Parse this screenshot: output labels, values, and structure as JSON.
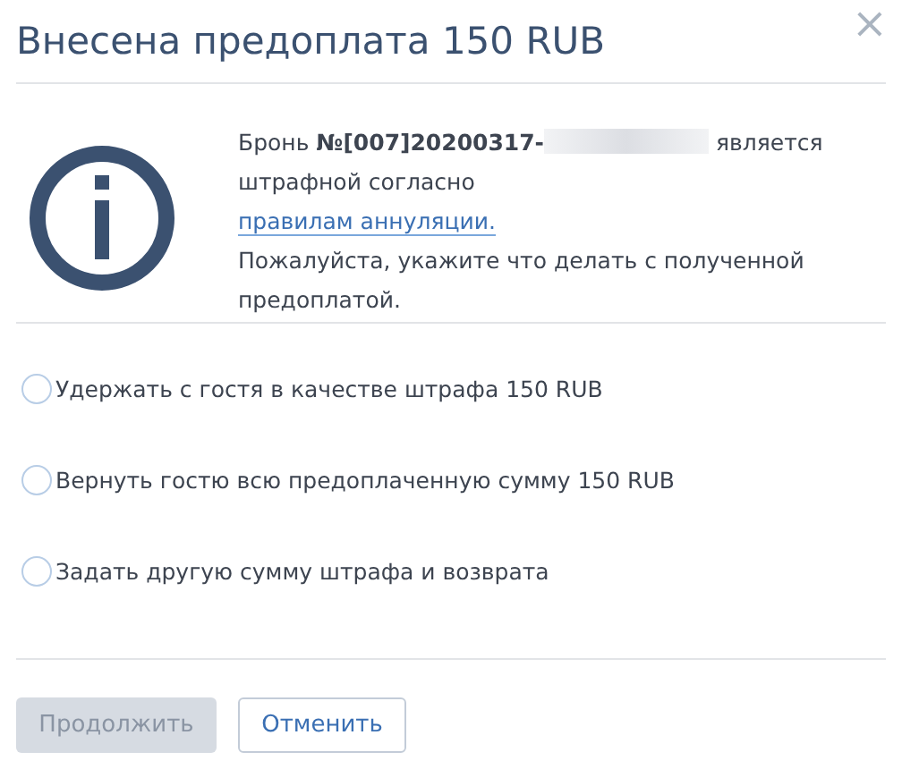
{
  "dialog": {
    "title": "Внесена предоплата 150 RUB",
    "close": "×"
  },
  "message": {
    "before": "Бронь **№[007]20200317-**",
    "redacted": true,
    "after": "является штрафной согласно",
    "link": "правилам аннуляции.",
    "note": "Пожалуйста, укажите что делать с полученной предоплатой."
  },
  "options": [
    {
      "label": "Удержать с гостя в качестве штрафа 150 RUB",
      "selected": false
    },
    {
      "label": "Вернуть гостю всю предоплаченную сумму 150 RUB",
      "selected": false
    },
    {
      "label": "Задать другую сумму штрафа и возврата",
      "selected": false
    }
  ],
  "buttons": [
    {
      "label": "Продолжить",
      "kind": "primary",
      "disabled": true
    },
    {
      "label": "Отменить",
      "kind": "secondary",
      "disabled": false
    }
  ]
}
